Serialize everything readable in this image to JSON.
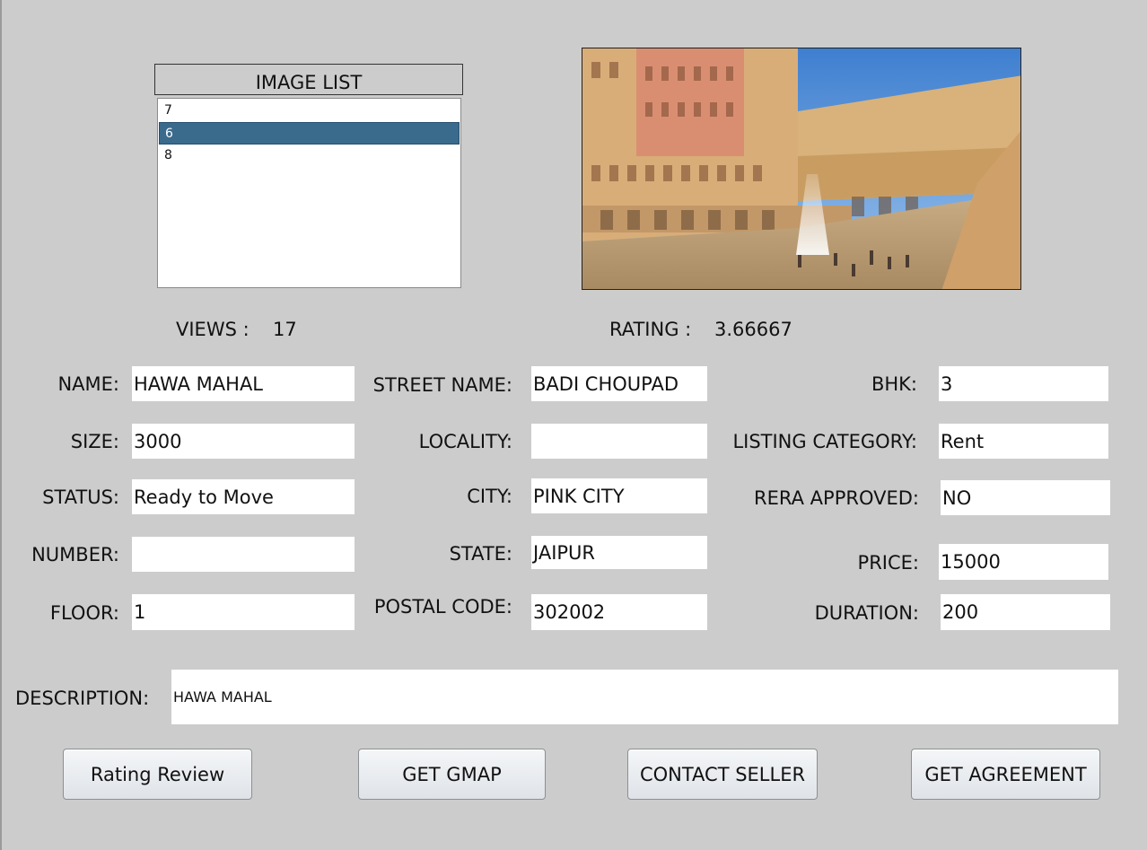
{
  "image_list": {
    "header": "IMAGE LIST",
    "items": [
      "7",
      "6",
      "8"
    ],
    "selected": "6"
  },
  "stats": {
    "views_label": "VIEWS :",
    "views_value": "17",
    "rating_label": "RATING :",
    "rating_value": "3.66667"
  },
  "fields": {
    "name": {
      "label": "NAME:",
      "value": "HAWA MAHAL"
    },
    "size": {
      "label": "SIZE:",
      "value": "3000"
    },
    "status": {
      "label": "STATUS:",
      "value": "Ready to Move"
    },
    "number": {
      "label": "NUMBER:",
      "value": ""
    },
    "floor": {
      "label": "FLOOR:",
      "value": "1"
    },
    "street": {
      "label": "STREET NAME:",
      "value": "BADI CHOUPAD"
    },
    "locality": {
      "label": "LOCALITY:",
      "value": ""
    },
    "city": {
      "label": "CITY:",
      "value": "PINK CITY"
    },
    "state": {
      "label": "STATE:",
      "value": "JAIPUR"
    },
    "postal": {
      "label": "POSTAL CODE:",
      "value": "302002"
    },
    "bhk": {
      "label": "BHK:",
      "value": "3"
    },
    "listing_category": {
      "label": "LISTING CATEGORY:",
      "value": "Rent"
    },
    "rera": {
      "label": "RERA APPROVED:",
      "value": "NO"
    },
    "price": {
      "label": "PRICE:",
      "value": "15000"
    },
    "duration": {
      "label": "DURATION:",
      "value": "200"
    },
    "description": {
      "label": "DESCRIPTION:",
      "value": "HAWA MAHAL"
    }
  },
  "buttons": {
    "rating_review": "Rating Review",
    "get_gmap": "GET GMAP",
    "contact_seller": "CONTACT SELLER",
    "get_agreement": "GET AGREEMENT"
  },
  "colors": {
    "background": "#cccccc",
    "selection": "#3a6a8c"
  }
}
